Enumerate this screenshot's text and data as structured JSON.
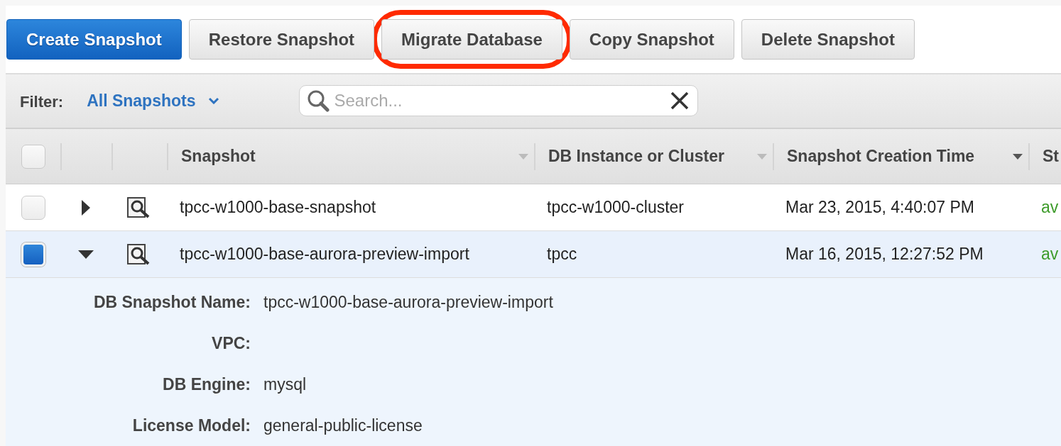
{
  "toolbar": {
    "buttons": [
      {
        "label": "Create Snapshot",
        "kind": "primary",
        "highlighted": false
      },
      {
        "label": "Restore Snapshot",
        "kind": "default",
        "highlighted": false
      },
      {
        "label": "Migrate Database",
        "kind": "default",
        "highlighted": true
      },
      {
        "label": "Copy Snapshot",
        "kind": "default",
        "highlighted": false
      },
      {
        "label": "Delete Snapshot",
        "kind": "default",
        "highlighted": false
      }
    ]
  },
  "filter": {
    "label": "Filter:",
    "value": "All Snapshots",
    "search": {
      "placeholder": "Search..."
    }
  },
  "table": {
    "select_all": {
      "checked": false
    },
    "columns": [
      {
        "label": "Snapshot",
        "sorted": false
      },
      {
        "label": "DB Instance or Cluster",
        "sorted": false
      },
      {
        "label": "Snapshot Creation Time",
        "sorted": true
      },
      {
        "label": "St"
      }
    ],
    "rows": [
      {
        "checked": false,
        "expanded": false,
        "cells": [
          "tpcc-w1000-base-snapshot",
          "tpcc-w1000-cluster",
          "Mar 23, 2015, 4:40:07 PM",
          "av"
        ]
      },
      {
        "checked": true,
        "expanded": true,
        "cells": [
          "tpcc-w1000-base-aurora-preview-import",
          "tpcc",
          "Mar 16, 2015, 12:27:52 PM",
          "av"
        ],
        "details": [
          {
            "label": "DB Snapshot Name:",
            "value": "tpcc-w1000-base-aurora-preview-import"
          },
          {
            "label": "VPC:"
          },
          {
            "label": "DB Engine:",
            "value": "mysql"
          },
          {
            "label": "License Model:",
            "value": "general-public-license"
          }
        ]
      }
    ]
  }
}
